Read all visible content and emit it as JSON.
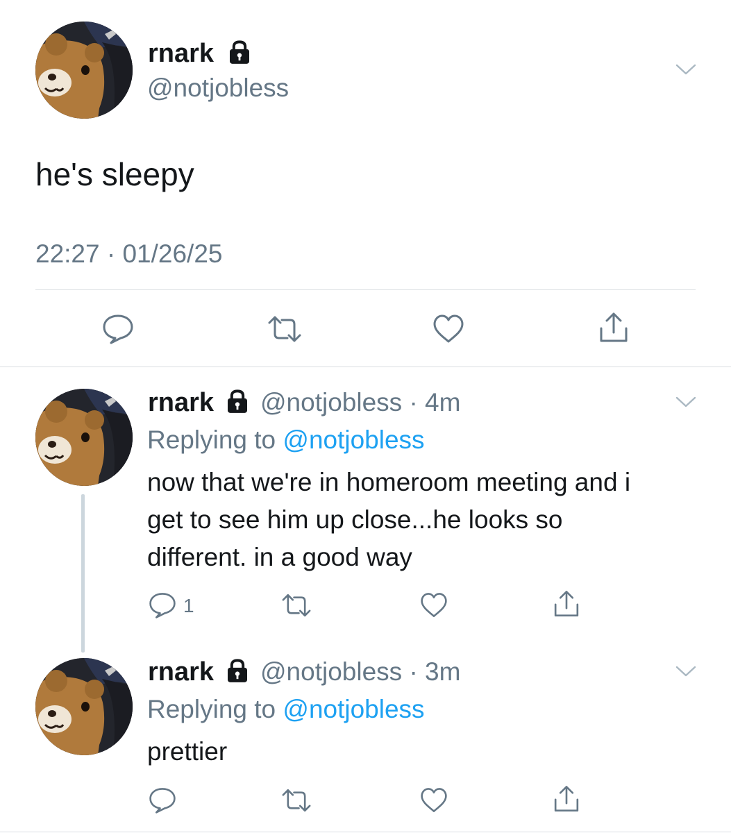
{
  "main_tweet": {
    "display_name": "rnark",
    "handle": "@notjobless",
    "text": "he's sleepy",
    "timestamp": "22:27 · 01/26/25",
    "icons": {
      "lock": "lock-icon",
      "menu": "chevron-down-icon"
    }
  },
  "replies": [
    {
      "display_name": "rnark",
      "handle_time": "@notjobless · 4m",
      "replying_prefix": "Replying to ",
      "replying_to": "@notjobless",
      "text_lines": [
        "now that we're in homeroom meeting and i",
        "get to see him up close...he looks so",
        "different. in a good way"
      ],
      "reply_count": "1"
    },
    {
      "display_name": "rnark",
      "handle_time": "@notjobless · 3m",
      "replying_prefix": "Replying to ",
      "replying_to": "@notjobless",
      "text_lines": [
        "prettier"
      ],
      "reply_count": ""
    }
  ],
  "colors": {
    "text": "#14171a",
    "secondary": "#657786",
    "link": "#1da1f2",
    "divider": "#d9dde1",
    "thread_line": "#ccd6dd"
  }
}
